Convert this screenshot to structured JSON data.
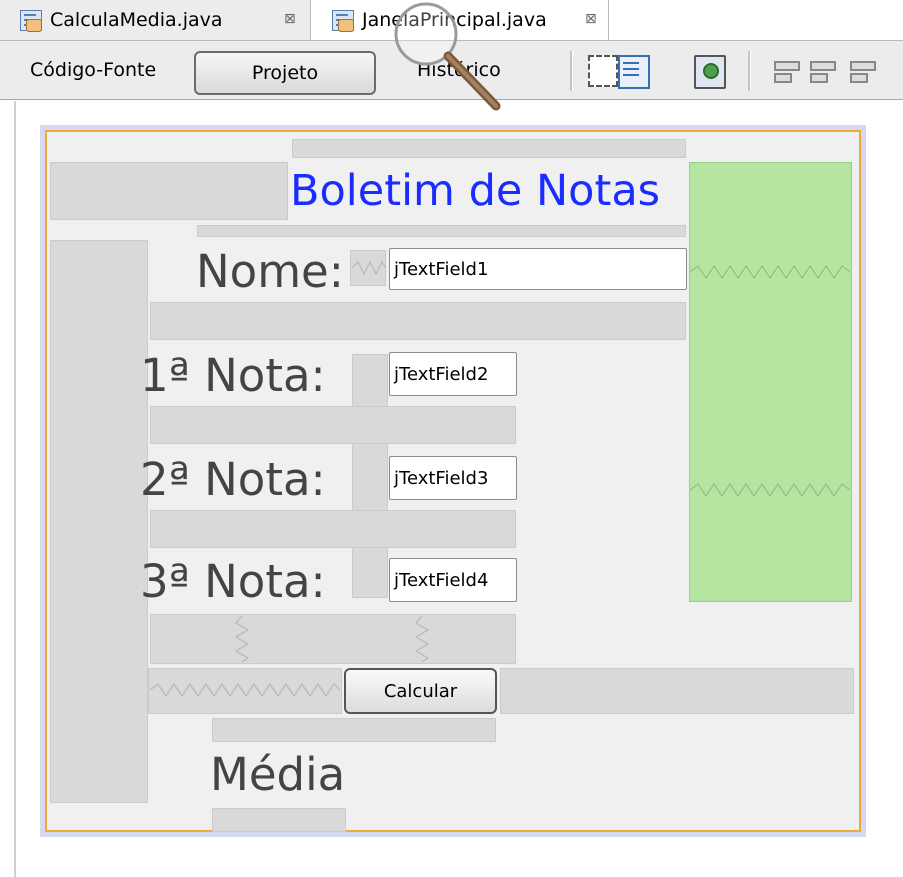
{
  "tabs": [
    {
      "label": "CalculaMedia.java",
      "close": "⊠",
      "active": false
    },
    {
      "label": "JanelaPrincipal.java",
      "close": "⊠",
      "active": true
    }
  ],
  "toolbar": {
    "source_label": "Código-Fonte",
    "design_label": "Projeto",
    "history_label": "Histórico"
  },
  "form": {
    "title": "Boletim de Notas",
    "nome_label": "Nome:",
    "nota1_label": "1ª Nota:",
    "nota2_label": "2ª Nota:",
    "nota3_label": "3ª Nota:",
    "field1": "jTextField1",
    "field2": "jTextField2",
    "field3": "jTextField3",
    "field4": "jTextField4",
    "calc_label": "Calcular",
    "media_label": "Média"
  },
  "colors": {
    "title": "#1a2cff",
    "frame_border": "#f0a83a",
    "green_panel": "#b5e6a1"
  }
}
